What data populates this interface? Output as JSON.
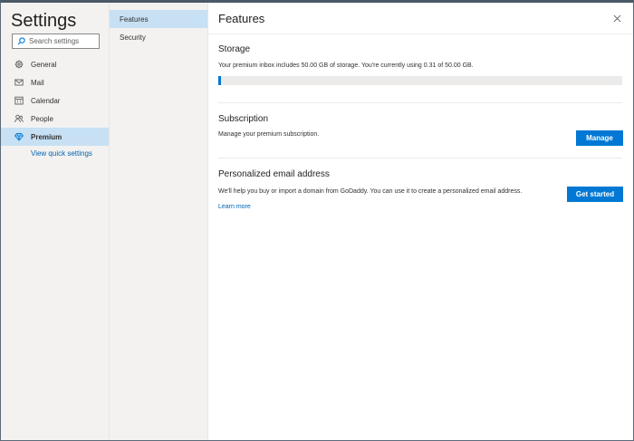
{
  "nav": {
    "title": "Settings",
    "search_placeholder": "Search settings",
    "items": [
      {
        "label": "General",
        "icon": "gear-icon"
      },
      {
        "label": "Mail",
        "icon": "envelope-icon"
      },
      {
        "label": "Calendar",
        "icon": "calendar-icon"
      },
      {
        "label": "People",
        "icon": "people-icon"
      },
      {
        "label": "Premium",
        "icon": "diamond-icon",
        "active": true
      }
    ],
    "quick_settings_link": "View quick settings"
  },
  "subnav": {
    "items": [
      {
        "label": "Features",
        "active": true
      },
      {
        "label": "Security"
      }
    ]
  },
  "content": {
    "title": "Features",
    "storage": {
      "heading": "Storage",
      "text": "Your premium inbox includes 50.00 GB of storage. You're currently using 0.31 of 50.00 GB.",
      "used_gb": 0.31,
      "total_gb": 50.0
    },
    "subscription": {
      "heading": "Subscription",
      "text": "Manage your premium subscription.",
      "button": "Manage"
    },
    "email": {
      "heading": "Personalized email address",
      "text": "We'll help you buy or import a domain from GoDaddy. You can use it to create a personalized email address.",
      "button": "Get started",
      "link": "Learn more"
    }
  },
  "colors": {
    "accent": "#0078d4",
    "selected": "#c7e0f4",
    "nav_bg": "#f3f2f1",
    "link": "#0063b1"
  }
}
